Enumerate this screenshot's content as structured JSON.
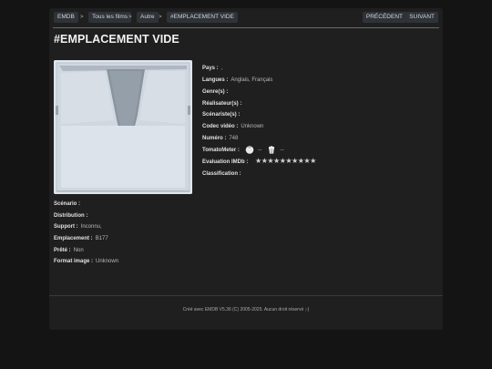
{
  "nav": {
    "breadcrumbs": [
      "EMDB",
      "Tous les films",
      "Autre",
      "#EMPLACEMENT VIDE"
    ],
    "separator": ">",
    "prev_label": "PRÉCÉDENT",
    "next_label": "SUIVANT"
  },
  "page_title": "#EMPLACEMENT VIDE",
  "details": {
    "pays": {
      "label": "Pays :",
      "value": ","
    },
    "langues": {
      "label": "Langues :",
      "value": "Anglais, Français"
    },
    "genres": {
      "label": "Genre(s) :",
      "value": ""
    },
    "realisateurs": {
      "label": "Réalisateur(s) :",
      "value": ""
    },
    "scenaristes": {
      "label": "Scénariste(s) :",
      "value": ""
    },
    "codec": {
      "label": "Codec vidéo :",
      "value": "Unknown"
    },
    "numero": {
      "label": "Numéro :",
      "value": "748"
    },
    "tomatometer": {
      "label": "TomatoMeter :",
      "critics": "--",
      "audience": "--"
    },
    "imdb": {
      "label": "Evaluation IMDb :",
      "stars": "★★★★★★★★★★",
      "rating": 0
    },
    "classification": {
      "label": "Classification :",
      "value": ""
    }
  },
  "info": {
    "scenario": {
      "label": "Scénario :",
      "value": ""
    },
    "distribution": {
      "label": "Distribution :",
      "value": ""
    },
    "support": {
      "label": "Support :",
      "value": "Inconnu,"
    },
    "emplacement": {
      "label": "Emplacement :",
      "value": "B177"
    },
    "prete": {
      "label": "Prêté :",
      "value": "Non"
    },
    "format": {
      "label": "Format image :",
      "value": "Unknown"
    }
  },
  "footer": "Créé avec EMDB V5.36 (C) 2005-2025. Aucun droit réservé ;-)",
  "colors": {
    "background": "#141414",
    "panel": "#1f1f1f",
    "button": "#2f3338"
  }
}
